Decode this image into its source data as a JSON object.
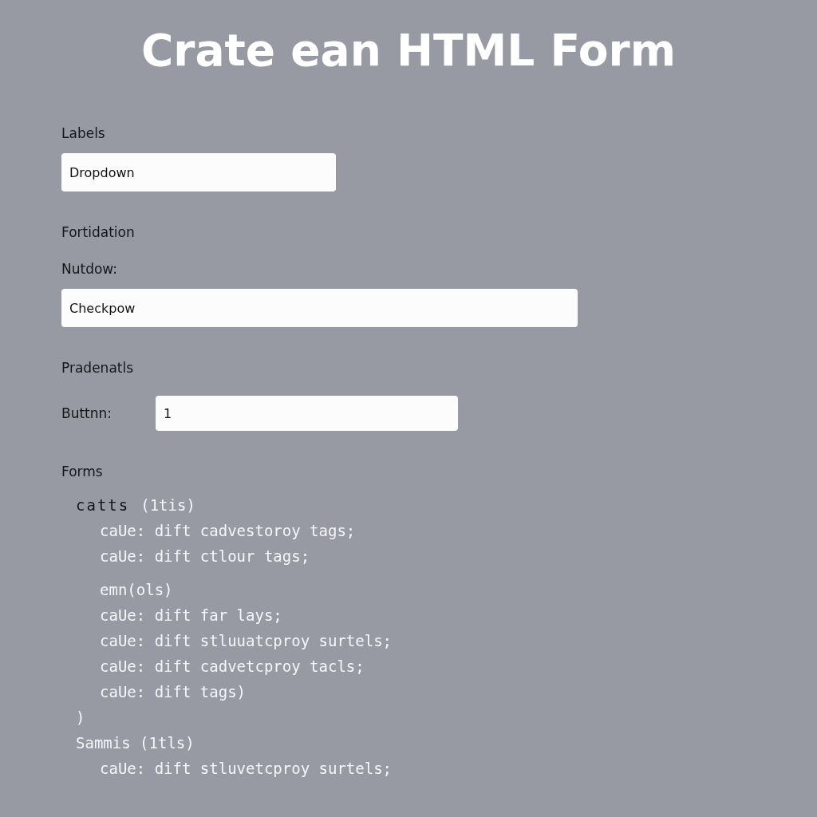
{
  "title": "Crate ean HTML Form",
  "form": [
    {
      "kind": "label",
      "text": "Labels"
    },
    {
      "kind": "field",
      "value": "Dropdown"
    },
    {
      "kind": "heading",
      "text": "Fortidation"
    },
    {
      "kind": "label",
      "text": "Nutdow:"
    },
    {
      "kind": "wide_field",
      "value": "Checkpow"
    },
    {
      "kind": "heading",
      "text": "Pradenatls"
    },
    {
      "kind": "inline",
      "label": "Buttnn:",
      "value": "1"
    },
    {
      "kind": "heading",
      "text": "Forms"
    }
  ],
  "code": [
    {
      "keyword": "catts",
      "text": "(1tis)",
      "children": [
        {
          "text": "caUe: dift cadvestoroy tags;"
        },
        {
          "text": "caUe: dift ctlour tags;"
        },
        {
          "text": "emn(ols)",
          "gap": true
        },
        {
          "text": "caUe: dift far lays;"
        },
        {
          "text": "caUe: dift stluuatcproy surtels;"
        },
        {
          "text": "caUe: dift cadvetcproy tacls;"
        },
        {
          "text": "caUe: dift tags)"
        }
      ]
    },
    {
      "text": ")"
    },
    {
      "text": "Sammis (1tls)",
      "children": [
        {
          "text": "caUe: dift stluvetcproy surtels;"
        }
      ]
    }
  ]
}
